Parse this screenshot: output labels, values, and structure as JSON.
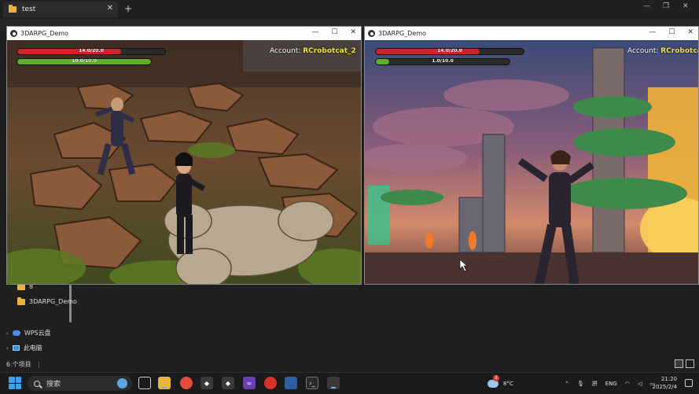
{
  "explorer": {
    "tab_title": "test",
    "tab_close": "✕",
    "tab_add": "+",
    "nav_items": [
      {
        "label": "8"
      },
      {
        "label": "3DARPG_Demo"
      },
      {
        "label": "WPS云盘"
      },
      {
        "label": "此电脑"
      }
    ],
    "status_text": "6 个项目"
  },
  "windows": [
    {
      "title": "3DARPG_Demo",
      "hp_text": "14.0/20.0",
      "hp_fraction": 0.7,
      "mp_text": "10.0/10.0",
      "mp_fraction": 1.0,
      "account_label": "Account:",
      "account_name": "RCrobotcat_2"
    },
    {
      "title": "3DARPG_Demo",
      "hp_text": "14.0/20.0",
      "hp_fraction": 0.7,
      "mp_text": "1.0/10.0",
      "mp_fraction": 0.1,
      "account_label": "Account:",
      "account_name": "RCrobotcat"
    }
  ],
  "taskbar": {
    "search_placeholder": "搜索",
    "weather_badge": "1",
    "weather_temp": "8°C",
    "lang": "ENG",
    "time": "21:20",
    "date": "2025/2/4"
  },
  "colors": {
    "hp": "#c8262a",
    "mp": "#5fae2e",
    "accent": "#f3e443"
  }
}
